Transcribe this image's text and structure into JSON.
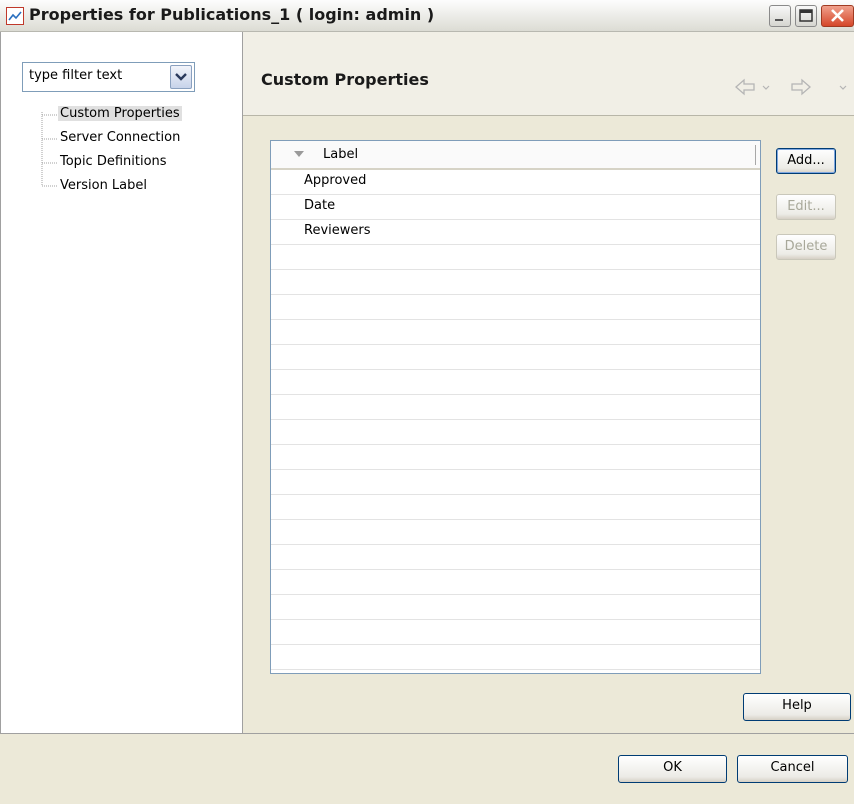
{
  "window": {
    "title": "Properties for Publications_1 ( login: admin )",
    "close_color": "#d5472a"
  },
  "filter": {
    "value": "type filter text"
  },
  "tree": {
    "items": [
      {
        "label": "Custom Properties",
        "selected": true
      },
      {
        "label": "Server Connection",
        "selected": false
      },
      {
        "label": "Topic Definitions",
        "selected": false
      },
      {
        "label": "Version Label",
        "selected": false
      }
    ]
  },
  "page": {
    "title": "Custom Properties"
  },
  "table": {
    "column_header": "Label",
    "rows": [
      "Approved",
      "Date",
      "Reviewers"
    ]
  },
  "buttons": {
    "add": "Add...",
    "edit": "Edit...",
    "delete": "Delete",
    "help": "Help",
    "ok": "OK",
    "cancel": "Cancel"
  },
  "icons": [
    "app-icon",
    "minimize-icon",
    "maximize-icon",
    "close-icon",
    "dropdown-arrow-icon",
    "back-arrow-icon",
    "forward-arrow-icon",
    "sort-indicator-icon"
  ]
}
